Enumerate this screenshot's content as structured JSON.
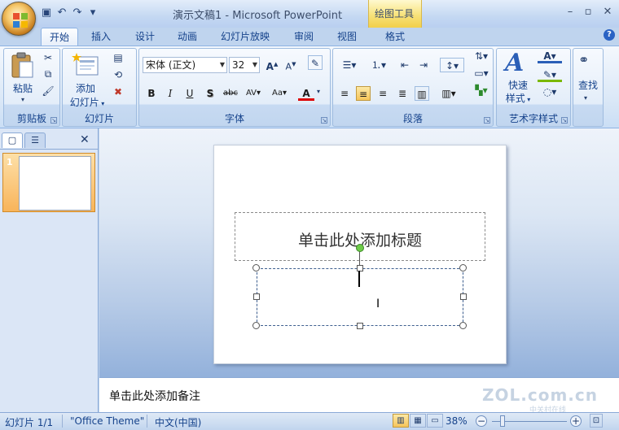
{
  "window": {
    "title": "演示文稿1 - Microsoft PowerPoint",
    "context_tab_label": "绘图工具",
    "qat": [
      "save-icon",
      "undo-icon",
      "redo-icon",
      "customize-icon"
    ]
  },
  "tabs": [
    "开始",
    "插入",
    "设计",
    "动画",
    "幻灯片放映",
    "审阅",
    "视图",
    "格式"
  ],
  "active_tab": "开始",
  "ribbon": {
    "clipboard": {
      "label": "剪贴板",
      "paste": "粘贴"
    },
    "slides": {
      "label": "幻灯片",
      "new_slide_line1": "添加",
      "new_slide_line2": "幻灯片"
    },
    "font": {
      "label": "字体",
      "font_name": "宋体 (正文)",
      "font_size": "32"
    },
    "paragraph": {
      "label": "段落"
    },
    "wordart": {
      "label": "艺术字样式",
      "quick_styles_line1": "快速",
      "quick_styles_line2": "样式"
    },
    "editing": {
      "label": "查找"
    }
  },
  "slide_panel": {
    "thumbnail_number": "1"
  },
  "slide": {
    "title_placeholder": "单击此处添加标题"
  },
  "notes": {
    "placeholder": "单击此处添加备注"
  },
  "statusbar": {
    "slide_info": "幻灯片 1/1",
    "theme": "\"Office Theme\"",
    "language": "中文(中国)",
    "zoom": "38%",
    "zoom_fraction": 0.38
  },
  "watermark": {
    "text": "ZOL.com.cn",
    "subtext": "中关村在线"
  },
  "colors": {
    "accent": "#15428b",
    "ribbon": "#dbe8f7",
    "selection": "#f6c45a"
  }
}
